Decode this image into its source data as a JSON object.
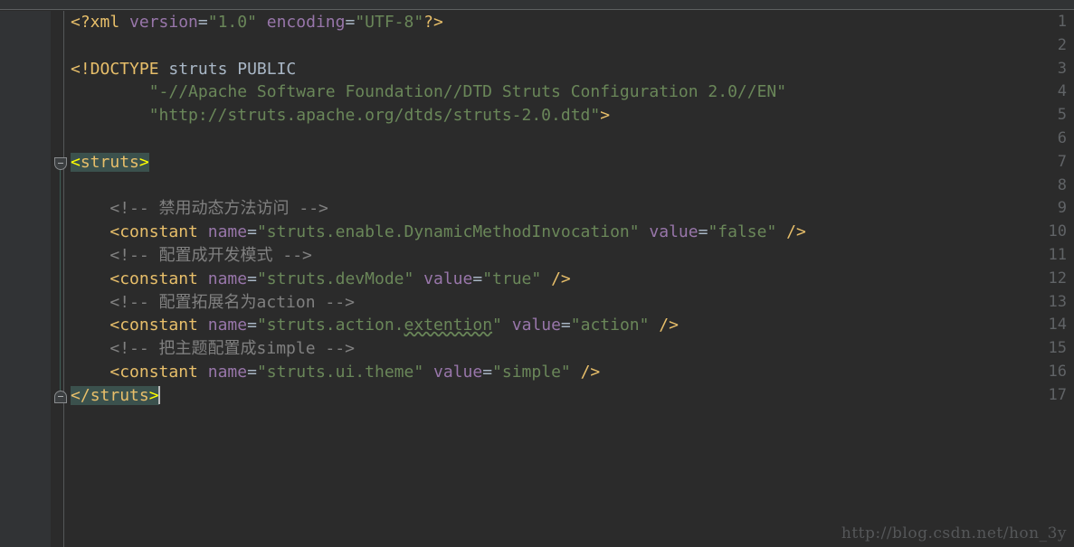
{
  "window": {
    "background": "#2b2b2b",
    "gutter_background": "#313335",
    "topbar_background": "#313335"
  },
  "editor": {
    "language": "xml",
    "filename_hint": "struts.xml",
    "line_numbers": [
      "1",
      "2",
      "3",
      "4",
      "5",
      "6",
      "7",
      "8",
      "9",
      "10",
      "11",
      "12",
      "13",
      "14",
      "15",
      "16",
      "17"
    ],
    "lines": [
      {
        "n": "1",
        "text": "<?xml version=\"1.0\" encoding=\"UTF-8\"?>"
      },
      {
        "n": "2",
        "text": ""
      },
      {
        "n": "3",
        "text": "<!DOCTYPE struts PUBLIC"
      },
      {
        "n": "4",
        "text": "        \"-//Apache Software Foundation//DTD Struts Configuration 2.0//EN\""
      },
      {
        "n": "5",
        "text": "        \"http://struts.apache.org/dtds/struts-2.0.dtd\">"
      },
      {
        "n": "6",
        "text": ""
      },
      {
        "n": "7",
        "text": "<struts>"
      },
      {
        "n": "8",
        "text": ""
      },
      {
        "n": "9",
        "text": "    <!-- 禁用动态方法访问 -->"
      },
      {
        "n": "10",
        "text": "    <constant name=\"struts.enable.DynamicMethodInvocation\" value=\"false\" />"
      },
      {
        "n": "11",
        "text": "    <!-- 配置成开发模式 -->"
      },
      {
        "n": "12",
        "text": "    <constant name=\"struts.devMode\" value=\"true\" />"
      },
      {
        "n": "13",
        "text": "    <!-- 配置拓展名为action -->"
      },
      {
        "n": "14",
        "text": "    <constant name=\"struts.action.extention\" value=\"action\" />"
      },
      {
        "n": "15",
        "text": "    <!-- 把主题配置成simple -->"
      },
      {
        "n": "16",
        "text": "    <constant name=\"struts.ui.theme\" value=\"simple\" />"
      },
      {
        "n": "17",
        "text": "</struts>"
      }
    ],
    "tokens": {
      "l1": {
        "open": "<?xml",
        "attr1": " version",
        "eq": "=",
        "v1": "\"1.0\"",
        "attr2": " encoding",
        "v2": "\"UTF-8\"",
        "close": "?>"
      },
      "l3": {
        "doctype": "<!DOCTYPE",
        "name": " struts PUBLIC"
      },
      "l4": {
        "indent": "        ",
        "text": "\"-//Apache Software Foundation//DTD Struts Configuration 2.0//EN\""
      },
      "l5": {
        "indent": "        ",
        "text": "\"http://struts.apache.org/dtds/struts-2.0.dtd\"",
        "gt": ">"
      },
      "l7": {
        "lt": "<",
        "name": "struts",
        "gt": ">"
      },
      "l9": {
        "indent": "    ",
        "text": "<!-- 禁用动态方法访问 -->"
      },
      "l10": {
        "indent": "    ",
        "lt": "<",
        "tag": "constant",
        "attr1": " name",
        "eq1": "=",
        "v1": "\"struts.enable.DynamicMethodInvocation\"",
        "attr2": " value",
        "eq2": "=",
        "v2": "\"false\"",
        "selfclose": " />"
      },
      "l11": {
        "indent": "    ",
        "text": "<!-- 配置成开发模式 -->"
      },
      "l12": {
        "indent": "    ",
        "lt": "<",
        "tag": "constant",
        "attr1": " name",
        "eq1": "=",
        "v1": "\"struts.devMode\"",
        "attr2": " value",
        "eq2": "=",
        "v2": "\"true\"",
        "selfclose": " />"
      },
      "l13": {
        "indent": "    ",
        "text": "<!-- 配置拓展名为action -->"
      },
      "l14": {
        "indent": "    ",
        "lt": "<",
        "tag": "constant",
        "attr1": " name",
        "eq1": "=",
        "v1a": "\"struts.action.",
        "v1b": "extention",
        "v1c": "\"",
        "attr2": " value",
        "eq2": "=",
        "v2": "\"action\"",
        "selfclose": " />"
      },
      "l15": {
        "indent": "    ",
        "text": "<!-- 把主题配置成simple -->"
      },
      "l16": {
        "indent": "    ",
        "lt": "<",
        "tag": "constant",
        "attr1": " name",
        "eq1": "=",
        "v1": "\"struts.ui.theme\"",
        "attr2": " value",
        "eq2": "=",
        "v2": "\"simple\"",
        "selfclose": " />"
      },
      "l17": {
        "lt": "</",
        "name": "struts",
        "gt": ">"
      }
    },
    "highlight": {
      "matching_tag_background": "#3b514d",
      "matching_bracket_color": "#ffff00",
      "caret_line": "17",
      "caret_color": "#bbbbbb"
    },
    "fold_markers": [
      {
        "line": "7",
        "state": "expanded"
      },
      {
        "line": "17",
        "state": "expanded"
      }
    ],
    "spellcheck_warnings": [
      {
        "line": "14",
        "word": "extention"
      }
    ],
    "colors": {
      "tag": "#e8bf6a",
      "attribute": "#9876aa",
      "value": "#6a8759",
      "comment": "#808080",
      "plain": "#a9b7c6",
      "linenumber": "#606366"
    }
  },
  "watermark": {
    "text": "http://blog.csdn.net/hon_3y"
  }
}
